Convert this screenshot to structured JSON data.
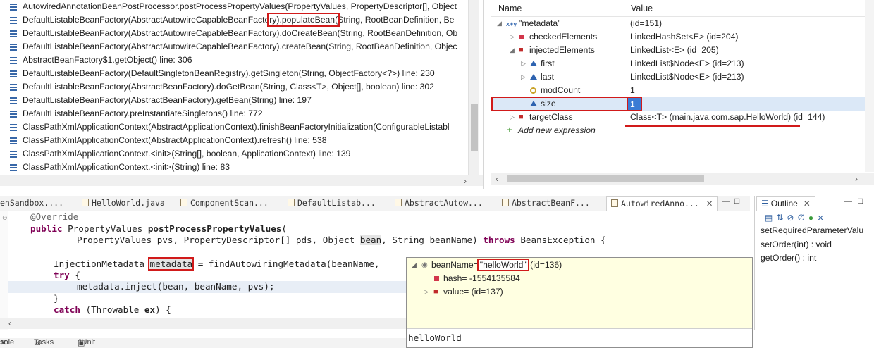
{
  "stack": {
    "frames": [
      "AutowiredAnnotationBeanPostProcessor.postProcessPropertyValues(PropertyValues, PropertyDescriptor[], Object",
      "DefaultListableBeanFactory(AbstractAutowireCapableBeanFactory).populateBean(String, RootBeanDefinition, Be",
      "DefaultListableBeanFactory(AbstractAutowireCapableBeanFactory).doCreateBean(String, RootBeanDefinition, Ob",
      "DefaultListableBeanFactory(AbstractAutowireCapableBeanFactory).createBean(String, RootBeanDefinition, Objec",
      "AbstractBeanFactory$1.getObject() line: 306",
      "DefaultListableBeanFactory(DefaultSingletonBeanRegistry).getSingleton(String, ObjectFactory<?>) line: 230",
      "DefaultListableBeanFactory(AbstractBeanFactory).doGetBean(String, Class<T>, Object[], boolean) line: 302",
      "DefaultListableBeanFactory(AbstractBeanFactory).getBean(String) line: 197",
      "DefaultListableBeanFactory.preInstantiateSingletons() line: 772",
      "ClassPathXmlApplicationContext(AbstractApplicationContext).finishBeanFactoryInitialization(ConfigurableListabl",
      "ClassPathXmlApplicationContext(AbstractApplicationContext).refresh() line: 538",
      "ClassPathXmlApplicationContext.<init>(String[], boolean, ApplicationContext) line: 139",
      "ClassPathXmlApplicationContext.<init>(String) line: 83"
    ],
    "frame1_parts": {
      "before": "DefaultListableBeanFactory(AbstractAutowireCapableBeanFacto",
      "highlight": "ry).populateBean(",
      "after": "String, RootBeanDefinition, Be"
    }
  },
  "variables": {
    "col_name": "Name",
    "col_value": "Value",
    "rows": [
      {
        "name": "\"metadata\"",
        "value": "(id=151)"
      },
      {
        "name": "checkedElements",
        "value": "LinkedHashSet<E>  (id=204)"
      },
      {
        "name": "injectedElements",
        "value": "LinkedList<E>  (id=205)"
      },
      {
        "name": "first",
        "value": "LinkedList$Node<E>  (id=213)"
      },
      {
        "name": "last",
        "value": "LinkedList$Node<E>  (id=213)"
      },
      {
        "name": "modCount",
        "value": "1"
      },
      {
        "name": "size",
        "value": "1"
      },
      {
        "name": "targetClass",
        "value": "Class<T> (main.java.com.sap.HelloWorld) (id=144)"
      }
    ],
    "add_expression": "Add new expression"
  },
  "tabs": [
    {
      "label": "enSandbox...."
    },
    {
      "label": "HelloWorld.java"
    },
    {
      "label": "ComponentScan..."
    },
    {
      "label": "DefaultListab..."
    },
    {
      "label": "AbstractAutow..."
    },
    {
      "label": "AbstractBeanF..."
    },
    {
      "label": "AutowiredAnno..."
    }
  ],
  "editor": {
    "l1": "@Override",
    "l2_kw": "public",
    "l2_rest": " PropertyValues ",
    "l2_method": "postProcessPropertyValues",
    "l2_end": "(",
    "l3_a": "PropertyValues pvs, PropertyDescriptor[] pds, Object ",
    "l3_bean": "bean",
    "l3_b": ", String beanName) ",
    "l3_throws": "throws",
    "l3_c": " BeansException {",
    "l5_a": "InjectionMetadata ",
    "l5_meta": "metadata",
    "l5_b": " = findAutowiringMetadata(beanName,",
    "l6_kw": "try",
    "l6_rest": " {",
    "l7": "metadata.inject(bean, beanName, pvs);",
    "l8": "}",
    "l9_kw": "catch",
    "l9_a": " (Throwable ",
    "l9_ex": "ex",
    "l9_b": ") {"
  },
  "popup": {
    "root_prefix": "beanName=",
    "root_value": "\"helloWorld\"",
    "root_suffix": " (id=136)",
    "hash": "hash= -1554135584",
    "value": "value= (id=137)",
    "detail": "helloWorld"
  },
  "outline": {
    "title": "Outline",
    "items": [
      "setRequiredParameterValu",
      "setOrder(int) : void",
      "getOrder() : int"
    ]
  },
  "bottom_tabs": [
    "sole",
    "Tasks",
    "JUnit"
  ]
}
